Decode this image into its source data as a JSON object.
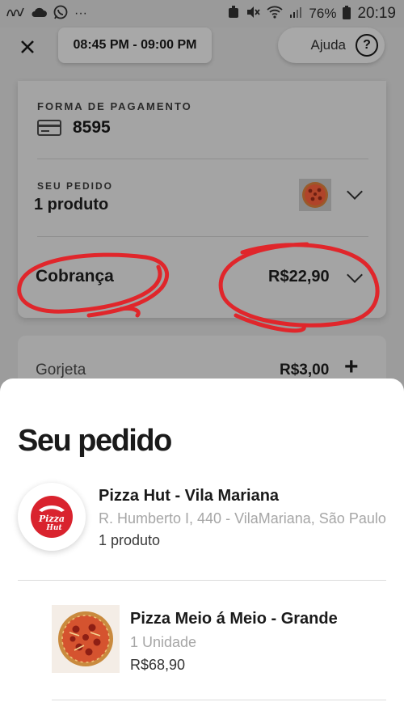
{
  "status_bar": {
    "left_icons": [
      "nfc-icon",
      "cloud-icon",
      "whatsapp-icon",
      "more-icon"
    ],
    "more_glyph": "···",
    "battery": "76%",
    "time": "20:19"
  },
  "topbar": {
    "time_window": "08:45 PM - 09:00 PM",
    "help_label": "Ajuda",
    "help_glyph": "?"
  },
  "card": {
    "payment_heading": "FORMA DE PAGAMENTO",
    "payment_number": "8595",
    "order_heading": "SEU PEDIDO",
    "order_count": "1 produto",
    "charge_label": "Cobrança",
    "charge_value": "R$22,90"
  },
  "tip": {
    "label": "Gorjeta",
    "value": "R$3,00",
    "plus_glyph": "+"
  },
  "sheet": {
    "title": "Seu pedido",
    "store": {
      "name": "Pizza Hut - Vila Mariana",
      "address": "R. Humberto I, 440 - VilaMariana, São Paulo",
      "count": "1 produto",
      "logo_text": "Pizza Hut"
    },
    "product": {
      "name": "Pizza Meio á Meio - Grande",
      "quantity": "1 Unidade",
      "price": "R$68,90"
    }
  },
  "colors": {
    "dim_background": "#9c9c9c",
    "annotation_red": "#e0262b",
    "logo_red": "#d9232e"
  }
}
